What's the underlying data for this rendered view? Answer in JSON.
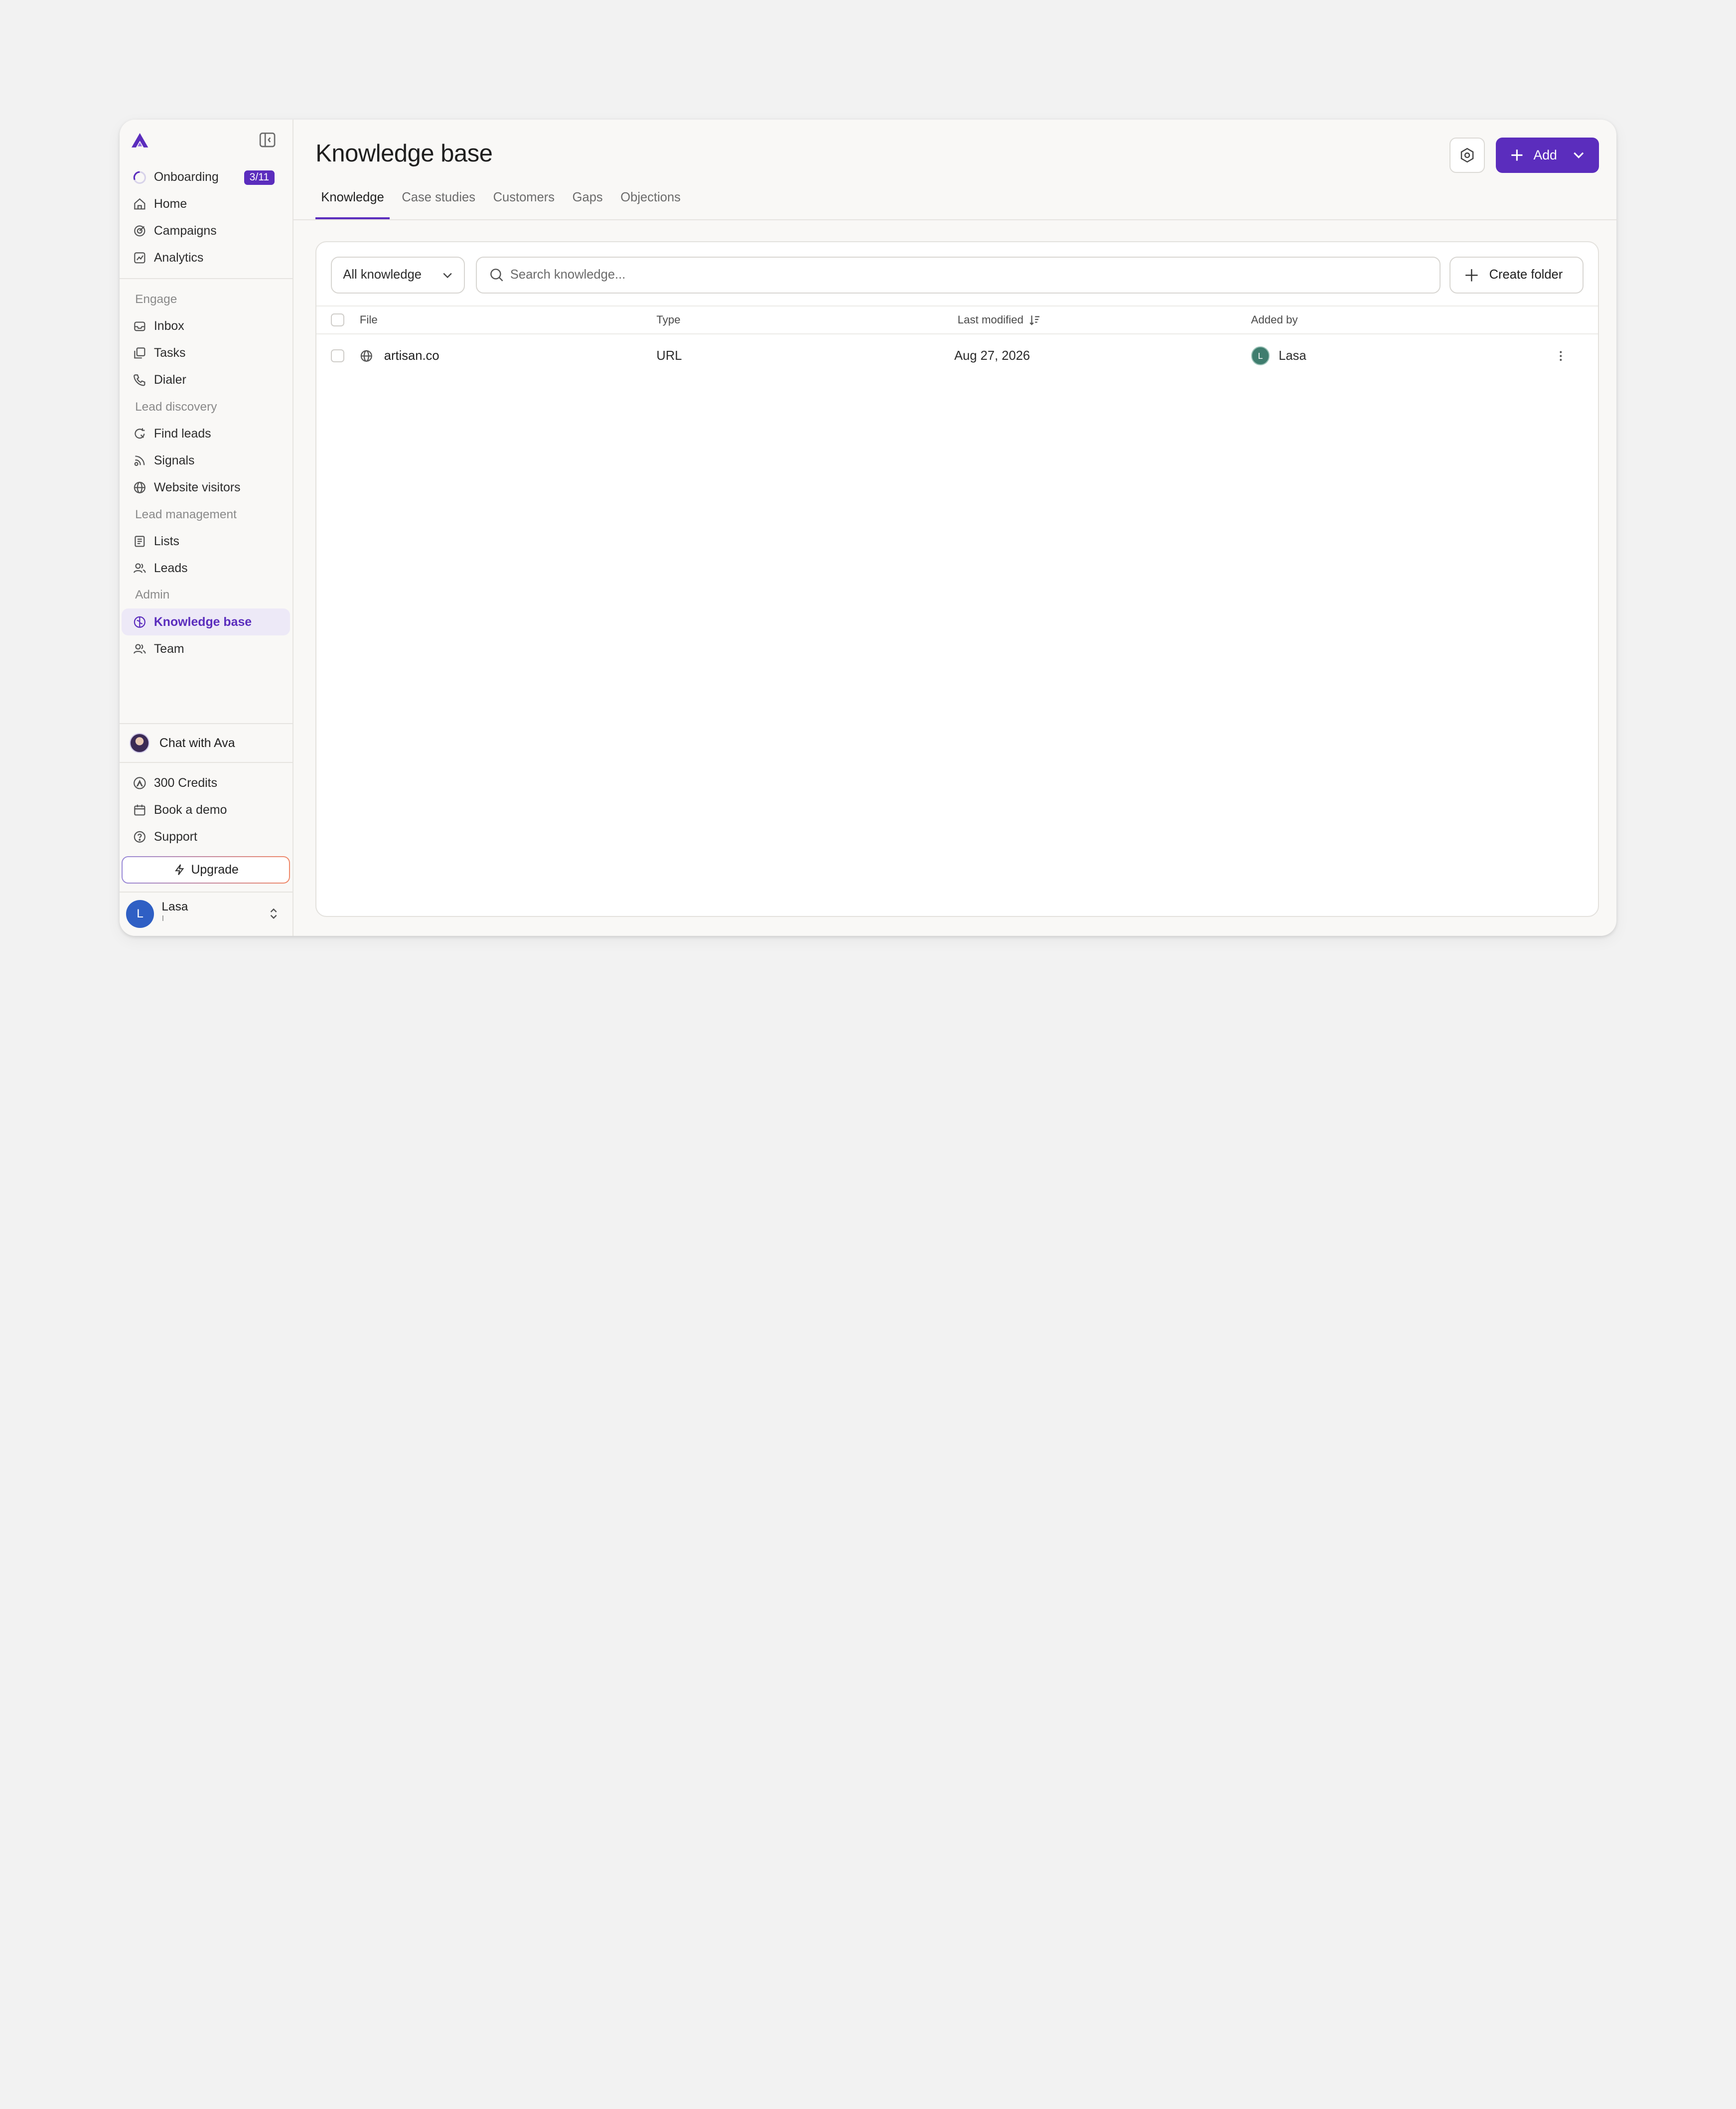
{
  "app": {
    "accent_color": "#5b2dbd"
  },
  "sidebar": {
    "logo_icon": "artisan-logo-icon",
    "collapse_icon": "sidebar-collapse-icon",
    "primary_items": [
      {
        "label": "Onboarding",
        "icon": "progress-circle-icon",
        "badge": "3/11"
      },
      {
        "label": "Home",
        "icon": "home-icon"
      },
      {
        "label": "Campaigns",
        "icon": "campaign-icon"
      },
      {
        "label": "Analytics",
        "icon": "chart-icon"
      }
    ],
    "sections": [
      {
        "title": "Engage",
        "items": [
          {
            "label": "Inbox",
            "icon": "inbox-icon"
          },
          {
            "label": "Tasks",
            "icon": "tasks-icon"
          },
          {
            "label": "Dialer",
            "icon": "phone-icon"
          }
        ]
      },
      {
        "title": "Lead discovery",
        "items": [
          {
            "label": "Find leads",
            "icon": "refresh-search-icon"
          },
          {
            "label": "Signals",
            "icon": "signal-icon"
          },
          {
            "label": "Website visitors",
            "icon": "globe-icon"
          }
        ]
      },
      {
        "title": "Lead management",
        "items": [
          {
            "label": "Lists",
            "icon": "list-icon"
          },
          {
            "label": "Leads",
            "icon": "users-icon"
          }
        ]
      },
      {
        "title": "Admin",
        "items": [
          {
            "label": "Knowledge base",
            "icon": "brain-icon",
            "active": true
          },
          {
            "label": "Team",
            "icon": "team-icon"
          }
        ]
      }
    ],
    "chat": {
      "label": "Chat with Ava"
    },
    "bottom_items": [
      {
        "label": "300 Credits",
        "icon": "credits-icon"
      },
      {
        "label": "Book a demo",
        "icon": "calendar-icon"
      },
      {
        "label": "Support",
        "icon": "help-icon"
      }
    ],
    "upgrade_label": "Upgrade",
    "user": {
      "initial": "L",
      "name": "Lasa",
      "subtitle": "L..."
    }
  },
  "header": {
    "title": "Knowledge base",
    "add_label": "Add",
    "tabs": [
      {
        "label": "Knowledge",
        "active": true
      },
      {
        "label": "Case studies"
      },
      {
        "label": "Customers"
      },
      {
        "label": "Gaps"
      },
      {
        "label": "Objections"
      }
    ]
  },
  "toolbar": {
    "filter_value": "All knowledge",
    "search_placeholder": "Search knowledge...",
    "create_folder_label": "Create folder"
  },
  "table": {
    "columns": [
      "File",
      "Type",
      "Last modified",
      "Added by"
    ],
    "rows": [
      {
        "file": "artisan.co",
        "type": "URL",
        "last_modified": "Aug 27, 2026",
        "added_by": "Lasa",
        "added_by_initial": "L"
      }
    ]
  }
}
